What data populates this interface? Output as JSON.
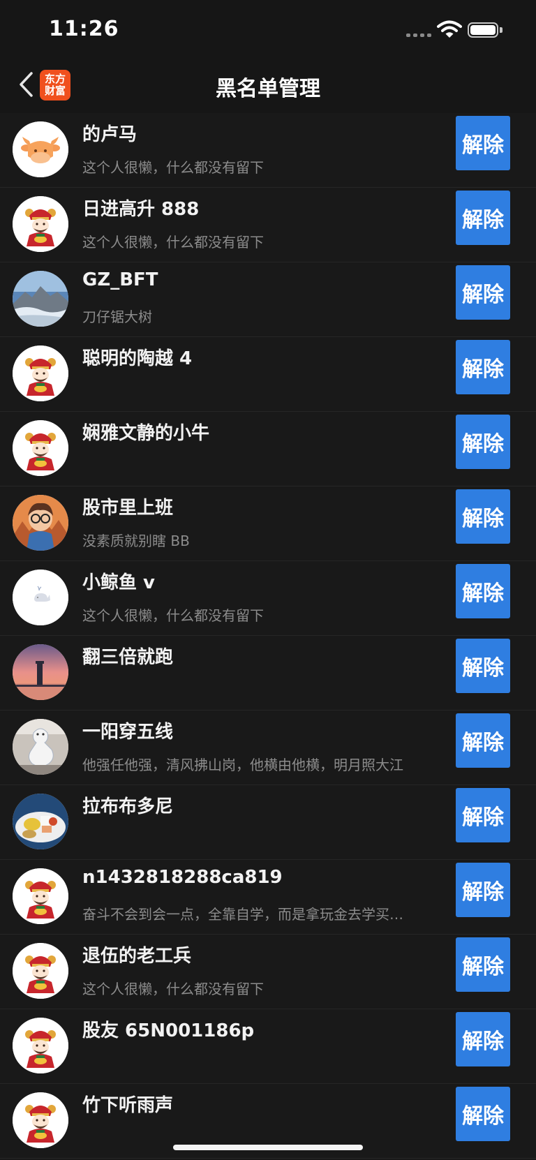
{
  "status_bar": {
    "time": "11:26"
  },
  "nav": {
    "title": "黑名单管理",
    "logo_line1": "东方",
    "logo_line2": "财富"
  },
  "list": {
    "items": [
      {
        "name": "的卢马",
        "bio": "这个人很懒，什么都没有留下",
        "avatar": "cow-avatar-icon",
        "action": "解除"
      },
      {
        "name": "日进高升 888",
        "bio": "这个人很懒，什么都没有留下",
        "avatar": "god-of-wealth-avatar-icon",
        "action": "解除"
      },
      {
        "name": "GZ_BFT",
        "bio": "刀仔锯大树",
        "avatar": "mountain-photo-avatar",
        "action": "解除"
      },
      {
        "name": "聪明的陶越 4",
        "bio": "",
        "avatar": "god-of-wealth-avatar-icon",
        "action": "解除"
      },
      {
        "name": "娴雅文静的小牛",
        "bio": "",
        "avatar": "god-of-wealth-avatar-icon",
        "action": "解除"
      },
      {
        "name": "股市里上班",
        "bio": "没素质就别瞎 BB",
        "avatar": "cartoon-boy-avatar",
        "action": "解除"
      },
      {
        "name": "小鲸鱼 v",
        "bio": "这个人很懒，什么都没有留下",
        "avatar": "whale-avatar-icon",
        "action": "解除"
      },
      {
        "name": "翻三倍就跑",
        "bio": "",
        "avatar": "sunset-lighthouse-avatar",
        "action": "解除"
      },
      {
        "name": "一阳穿五线",
        "bio": "他强任他强，清风拂山岗，他横由他横，明月照大江",
        "avatar": "white-statue-avatar",
        "action": "解除"
      },
      {
        "name": "拉布布多尼",
        "bio": "",
        "avatar": "food-plate-avatar",
        "action": "解除"
      },
      {
        "name": "n1432818288ca819",
        "bio": "奋斗不会到会一点，全靠自学，而是拿玩金去学买…",
        "avatar": "god-of-wealth-avatar-icon",
        "action": "解除"
      },
      {
        "name": "退伍的老工兵",
        "bio": "这个人很懒，什么都没有留下",
        "avatar": "god-of-wealth-avatar-icon",
        "action": "解除"
      },
      {
        "name": "股友 65N001186p",
        "bio": "",
        "avatar": "god-of-wealth-avatar-icon",
        "action": "解除"
      },
      {
        "name": "竹下听雨声",
        "bio": "",
        "avatar": "god-of-wealth-avatar-icon",
        "action": "解除"
      }
    ]
  },
  "colors": {
    "background": "#191919",
    "button": "#2f7ee1",
    "logo": "#f0501e",
    "secondary_text": "#8c8c8c"
  }
}
